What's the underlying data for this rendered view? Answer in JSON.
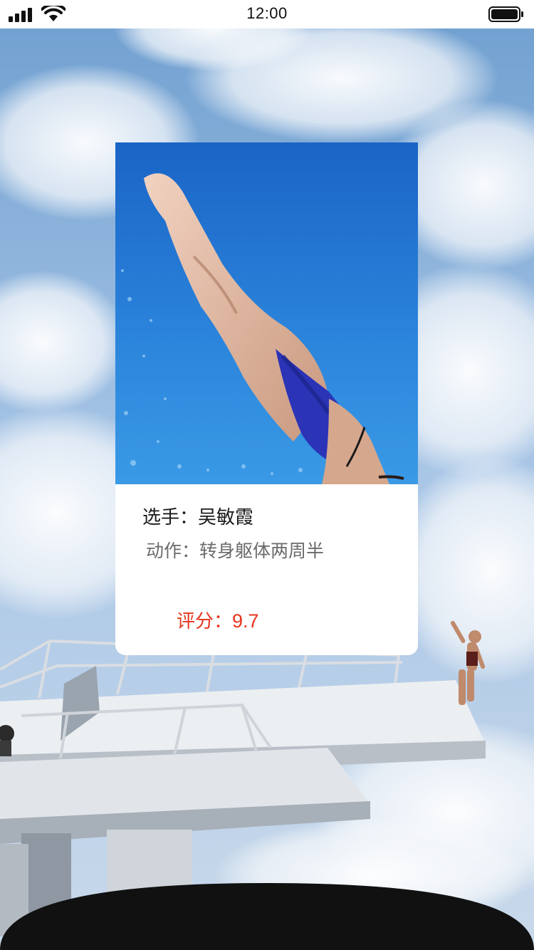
{
  "status_bar": {
    "time": "12:00",
    "signal_icon": "cellular-signal-icon",
    "wifi_icon": "wifi-icon",
    "battery_icon": "battery-icon"
  },
  "background": {
    "scene": "sky-with-clouds-and-diving-platform"
  },
  "card": {
    "photo": "diver-photo",
    "athlete_label": "选手：",
    "athlete_name": "吴敏霞",
    "move_label": "动作：",
    "move_name": "转身躯体两周半",
    "score_label": "评分：",
    "score_value": "9.7"
  },
  "colors": {
    "score": "#e8341c",
    "bottom_bar": "#111111",
    "card_bg": "#ffffff"
  }
}
